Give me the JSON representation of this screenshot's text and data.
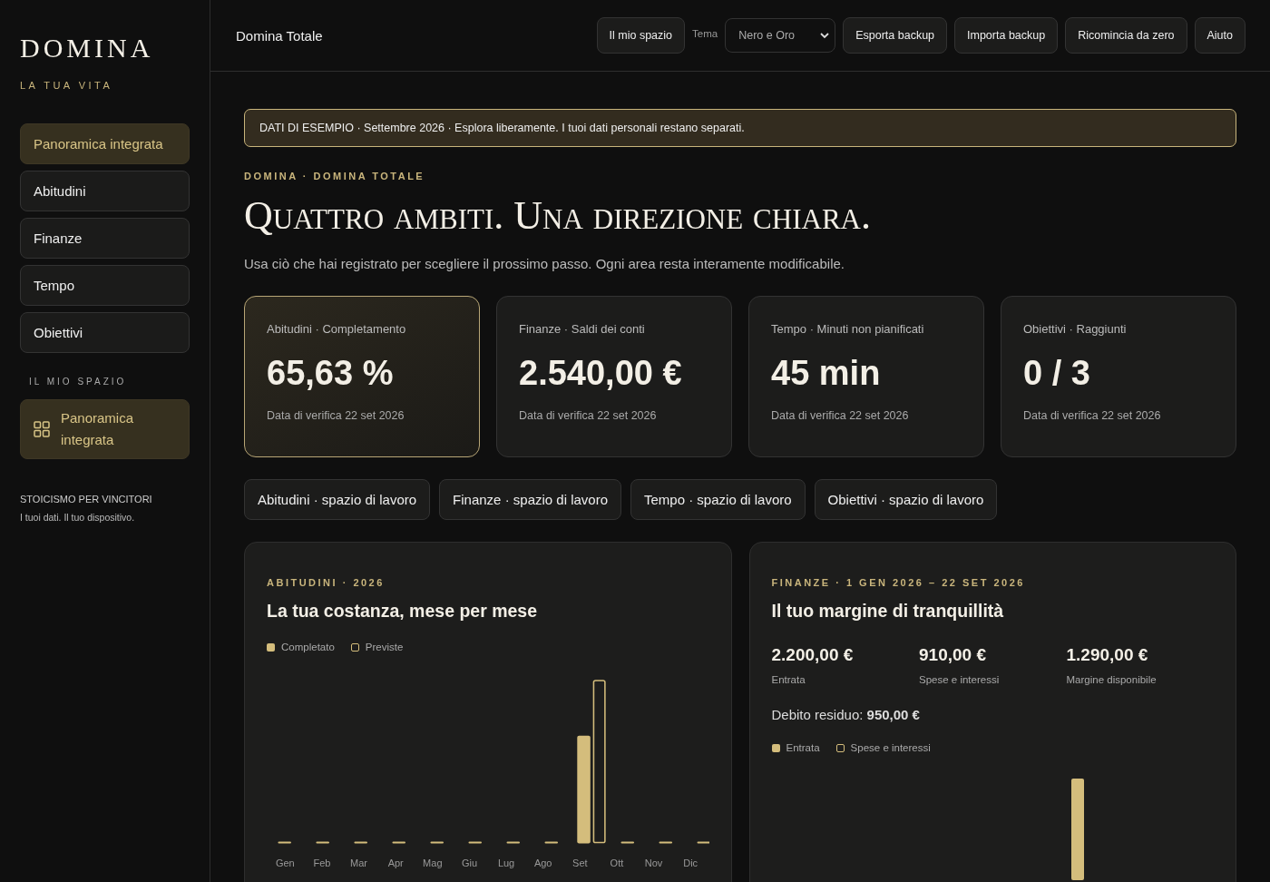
{
  "sidebar": {
    "logo": "DOMINA",
    "tagline": "LA TUA VITA",
    "items": [
      {
        "label": "Panoramica integrata",
        "selected": true
      },
      {
        "label": "Abitudini",
        "selected": false
      },
      {
        "label": "Finanze",
        "selected": false
      },
      {
        "label": "Tempo",
        "selected": false
      },
      {
        "label": "Obiettivi",
        "selected": false
      }
    ],
    "section_title": "IL MIO SPAZIO",
    "space_items": [
      {
        "label": "Panoramica integrata",
        "selected": true
      }
    ],
    "footer_title": "STOICISMO PER VINCITORI",
    "footer_text": "I tuoi dati. Il tuo dispositivo."
  },
  "topbar": {
    "title": "Domina Totale",
    "space_button": "Il mio spazio",
    "theme_label": "Tema",
    "theme_value": "Nero e Oro",
    "buttons": [
      "Esporta backup",
      "Importa backup",
      "Ricomincia da zero",
      "Aiuto"
    ]
  },
  "banner": "DATI DI ESEMPIO · Settembre 2026 · Esplora liberamente. I tuoi dati personali restano separati.",
  "eyebrow": "DOMINA · DOMINA TOTALE",
  "heading": "Quattro ambiti. Una direzione chiara.",
  "intro": "Usa ciò che hai registrato per scegliere il prossimo passo. Ogni area resta interamente modificabile.",
  "kpis": [
    {
      "label": "Abitudini · Completamento",
      "value": "65,63 %",
      "note": "Data di verifica 22 set 2026",
      "selected": true
    },
    {
      "label": "Finanze · Saldi dei conti",
      "value": "2.540,00 €",
      "note": "Data di verifica 22 set 2026",
      "selected": false
    },
    {
      "label": "Tempo · Minuti non pianificati",
      "value": "45 min",
      "note": "Data di verifica 22 set 2026",
      "selected": false
    },
    {
      "label": "Obiettivi · Raggiunti",
      "value": "0 / 3",
      "note": "Data di verifica 22 set 2026",
      "selected": false
    }
  ],
  "workspaces": [
    "Abitudini · spazio di lavoro",
    "Finanze · spazio di lavoro",
    "Tempo · spazio di lavoro",
    "Obiettivi · spazio di lavoro"
  ],
  "habits_panel": {
    "eyebrow": "ABITUDINI · 2026",
    "title": "La tua costanza, mese per mese",
    "legend": [
      {
        "label": "Completato",
        "kind": "filled"
      },
      {
        "label": "Previste",
        "kind": "outline"
      }
    ],
    "months": [
      "Gen",
      "Feb",
      "Mar",
      "Apr",
      "Mag",
      "Giu",
      "Lug",
      "Ago",
      "Set",
      "Ott",
      "Nov",
      "Dic"
    ]
  },
  "finance_panel": {
    "eyebrow": "FINANZE · 1 GEN 2026 – 22 SET 2026",
    "title": "Il tuo margine di tranquillità",
    "stats": [
      {
        "value": "2.200,00 €",
        "label": "Entrata"
      },
      {
        "value": "910,00 €",
        "label": "Spese e interessi"
      },
      {
        "value": "1.290,00 €",
        "label": "Margine disponibile"
      }
    ],
    "debt": "Debito residuo: **950,00 €**",
    "legend": [
      {
        "label": "Entrata",
        "kind": "filled"
      },
      {
        "label": "Spese e interessi",
        "kind": "outline"
      }
    ]
  }
}
